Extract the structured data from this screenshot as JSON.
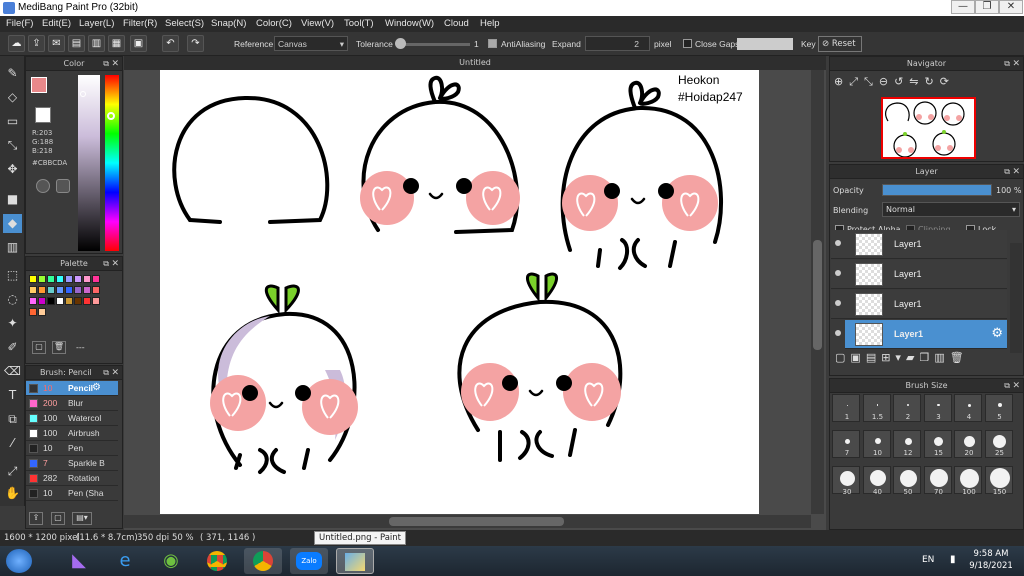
{
  "window": {
    "title": "MediBang Paint Pro (32bit)"
  },
  "menu": [
    "File(F)",
    "Edit(E)",
    "Layer(L)",
    "Filter(R)",
    "Select(S)",
    "Snap(N)",
    "Color(C)",
    "View(V)",
    "Tool(T)",
    "Window(W)",
    "Cloud",
    "Help"
  ],
  "toolbar": {
    "reference_label": "Reference",
    "reference_value": "Canvas",
    "tolerance_label": "Tolerance",
    "tolerance_value": "1",
    "antialiasing_label": "AntiAliasing",
    "expand_label": "Expand",
    "expand_value": "2",
    "expand_unit": "pixel",
    "close_gaps_label": "Close Gaps",
    "key_label": "Key",
    "reset_label": "Reset"
  },
  "color_panel": {
    "title": "Color",
    "r": "R:203",
    "g": "G:188",
    "b": "B:218",
    "hex": "#CBBCDA",
    "primary_color": "#e8888a",
    "secondary_color": "#ff8c1a"
  },
  "palette_panel": {
    "title": "Palette",
    "swatches": [
      "#ffff00",
      "#99ff33",
      "#33ff99",
      "#33ffff",
      "#9999ff",
      "#cc99ff",
      "#ff99cc",
      "#ff3399",
      "#ffcc66",
      "#ff9933",
      "#66cccc",
      "#6699ff",
      "#3366ff",
      "#9966cc",
      "#cc66cc",
      "#ff6666",
      "#ff66ff",
      "#cc00cc",
      "#000000",
      "#ffffff",
      "#cc9933",
      "#663300",
      "#ff3333",
      "#ff9999",
      "#ff6633",
      "#ffcc99"
    ],
    "dash_label": "---"
  },
  "brush_panel": {
    "title": "Brush: Pencil",
    "items": [
      {
        "size": "10",
        "name": "Pencil",
        "color": "#333333"
      },
      {
        "size": "200",
        "name": "Blur",
        "color": "#ff66cc"
      },
      {
        "size": "100",
        "name": "Watercol",
        "color": "#66ffff"
      },
      {
        "size": "100",
        "name": "Airbrush",
        "color": "#ffffff"
      },
      {
        "size": "10",
        "name": "Pen",
        "color": "#222222"
      },
      {
        "size": "7",
        "name": "Sparkle B",
        "color": "#3366ff"
      },
      {
        "size": "282",
        "name": "Rotation",
        "color": "#ff3333"
      },
      {
        "size": "10",
        "name": "Pen (Sha",
        "color": "#222222"
      }
    ]
  },
  "canvas": {
    "tab_title": "Untitled",
    "watermark_line1": "Heokon",
    "watermark_line2": "#Hoidap247"
  },
  "navigator": {
    "title": "Navigator"
  },
  "layer_panel": {
    "title": "Layer",
    "opacity_label": "Opacity",
    "opacity_value": "100 %",
    "opacity_level": 1.0,
    "blending_label": "Blending",
    "blending_value": "Normal",
    "protect_alpha_label": "Protect Alpha",
    "clipping_label": "Clipping",
    "lock_label": "Lock",
    "layers": [
      "Layer1",
      "Layer1",
      "Layer1",
      "Layer1"
    ],
    "selected_index": 3
  },
  "brush_size_panel": {
    "title": "Brush Size",
    "sizes": [
      "1",
      "1.5",
      "2",
      "3",
      "4",
      "5",
      "7",
      "10",
      "12",
      "15",
      "20",
      "25",
      "30",
      "40",
      "50",
      "70",
      "100",
      "150"
    ]
  },
  "status_bar": {
    "dimensions": "1600 * 1200 pixel",
    "physical": "(11.6 * 8.7cm)",
    "dpi": "350 dpi",
    "zoom": "50 %",
    "coords": "( 371, 1146 )",
    "tooltip": "Untitled.png - Paint"
  },
  "taskbar": {
    "language": "EN",
    "time": "9:58 AM",
    "date": "9/18/2021"
  }
}
